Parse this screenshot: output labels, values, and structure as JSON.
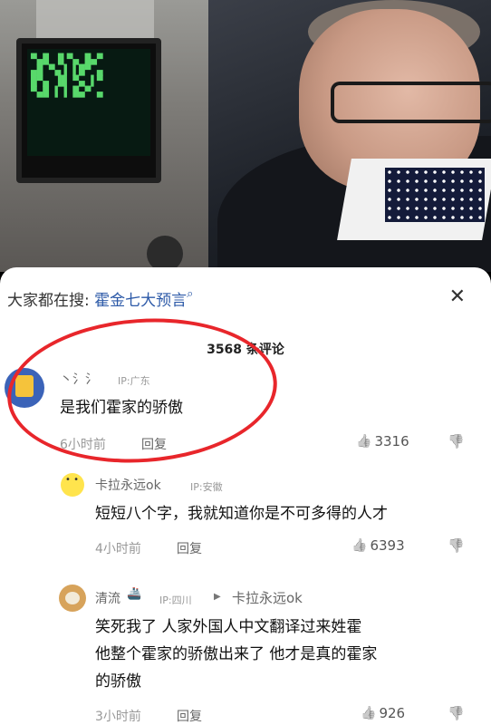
{
  "video": {
    "screen_glyphs": "▀▄█ ▐▌▀▄ █▄▀\n▄█ ▀▄▐ ▌█▀ ▄\n█▀▄ ▐█ ▀▄ ▌▀\n▀▄█ ▌▐ █▄▀ ▄"
  },
  "panel": {
    "search_prefix": "大家都在搜:",
    "search_keyword": "霍金七大预言",
    "search_icon": "⌕",
    "close_icon": "✕",
    "comment_count": "3568 条评论"
  },
  "comments": [
    {
      "username": "丶氵氵",
      "ip": "IP:广东",
      "text": "是我们霍家的骄傲",
      "time": "6小时前",
      "reply_label": "回复",
      "likes": "3316"
    },
    {
      "username": "卡拉永远ok",
      "ip": "IP:安徽",
      "text": "短短八个字，我就知道你是不可多得的人才",
      "time": "4小时前",
      "reply_label": "回复",
      "likes": "6393"
    },
    {
      "username": "清流",
      "ip": "IP:四川",
      "reply_to": "卡拉永远ok",
      "text_lines": [
        "笑死我了   人家外国人中文翻译过来姓霍",
        "他整个霍家的骄傲出来了  他才是真的霍家",
        "的骄傲"
      ],
      "time": "3小时前",
      "reply_label": "回复",
      "likes": "926"
    }
  ],
  "icons": {
    "like": "👍",
    "dislike": "👎",
    "reply_arrow": "▶"
  },
  "colors": {
    "keyword": "#2d5aa8",
    "annotation_ring": "#e8262b"
  }
}
